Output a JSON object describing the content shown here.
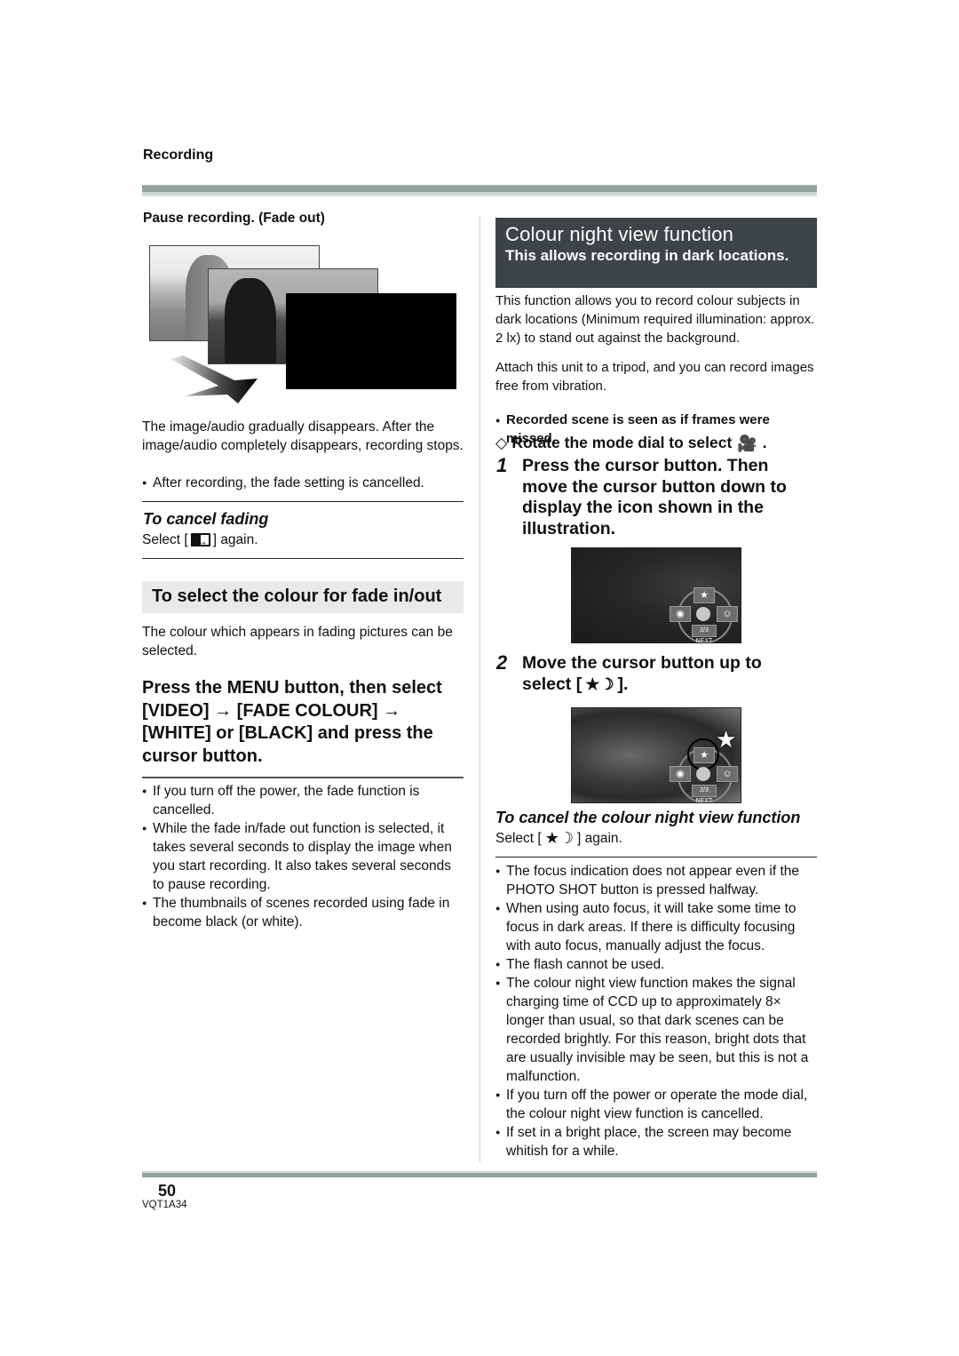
{
  "header": {
    "section": "Recording"
  },
  "left": {
    "pause_heading": "Pause recording. (Fade out)",
    "fade_description": "The image/audio gradually disappears. After the image/audio completely disappears, recording stops.",
    "fade_note": "After recording, the fade setting is cancelled.",
    "cancel_fading": {
      "title": "To cancel fading",
      "select_prefix": "Select [",
      "icon": "fade-icon",
      "select_suffix": "] again."
    },
    "subheading": "To select the colour for fade in/out",
    "colour_description": "The colour which appears in fading pictures can be selected.",
    "instruction": "Press the MENU button, then select [VIDEO] → [FADE COLOUR] → [WHITE] or [BLACK] and press the cursor button.",
    "notes": [
      "If you turn off the power, the fade function is cancelled.",
      "While the fade in/fade out function is selected, it takes several seconds to display the image when you start recording. It also takes several seconds to pause recording.",
      "The thumbnails of scenes recorded using fade in become black (or white)."
    ]
  },
  "right": {
    "title": "Colour night view function",
    "subtitle": "This allows recording in dark locations.",
    "intro_1": "This function allows you to record colour subjects in dark locations (Minimum required illumination: approx. 2 lx) to stand out against the background.",
    "intro_2": "Attach this unit to a tripod, and you can record images free from vibration.",
    "intro_note": "Recorded scene is seen as if frames were missed.",
    "prestep": {
      "marker": "◇",
      "text": "Rotate the mode dial to select",
      "icon": "video-camera-icon",
      "end": "."
    },
    "steps": [
      {
        "num": "1",
        "text": "Press the cursor button. Then move the cursor button down to display the icon shown in the illustration."
      },
      {
        "num": "2",
        "text_prefix": "Move the cursor button up to select [",
        "icon": "night-view-icon",
        "text_suffix": "]."
      }
    ],
    "screen_ui": {
      "page_label": "2/3 NEXT"
    },
    "cancel": {
      "title": "To cancel the colour night view function",
      "select_prefix": "Select [",
      "icon": "night-view-icon",
      "select_suffix": "] again."
    },
    "notes": [
      "The focus indication does not appear even if the PHOTO SHOT button is pressed halfway.",
      "When using auto focus, it will take some time to focus in dark areas. If there is difficulty focusing with auto focus, manually adjust the focus.",
      "The flash cannot be used.",
      "The colour night view function makes the signal charging time of CCD up to approximately 8× longer than usual, so that dark scenes can be recorded brightly. For this reason, bright dots that are usually invisible may be seen, but this is not a malfunction.",
      "If you turn off the power or operate the mode dial, the colour night view function is cancelled.",
      "If set in a bright place, the screen may become whitish for a while."
    ]
  },
  "footer": {
    "page_number": "50",
    "doc_code": "VQT1A34"
  },
  "colors": {
    "title_box": "#3d4446",
    "subhead_box": "#e8e9ea",
    "rule": "#8fa39f"
  }
}
